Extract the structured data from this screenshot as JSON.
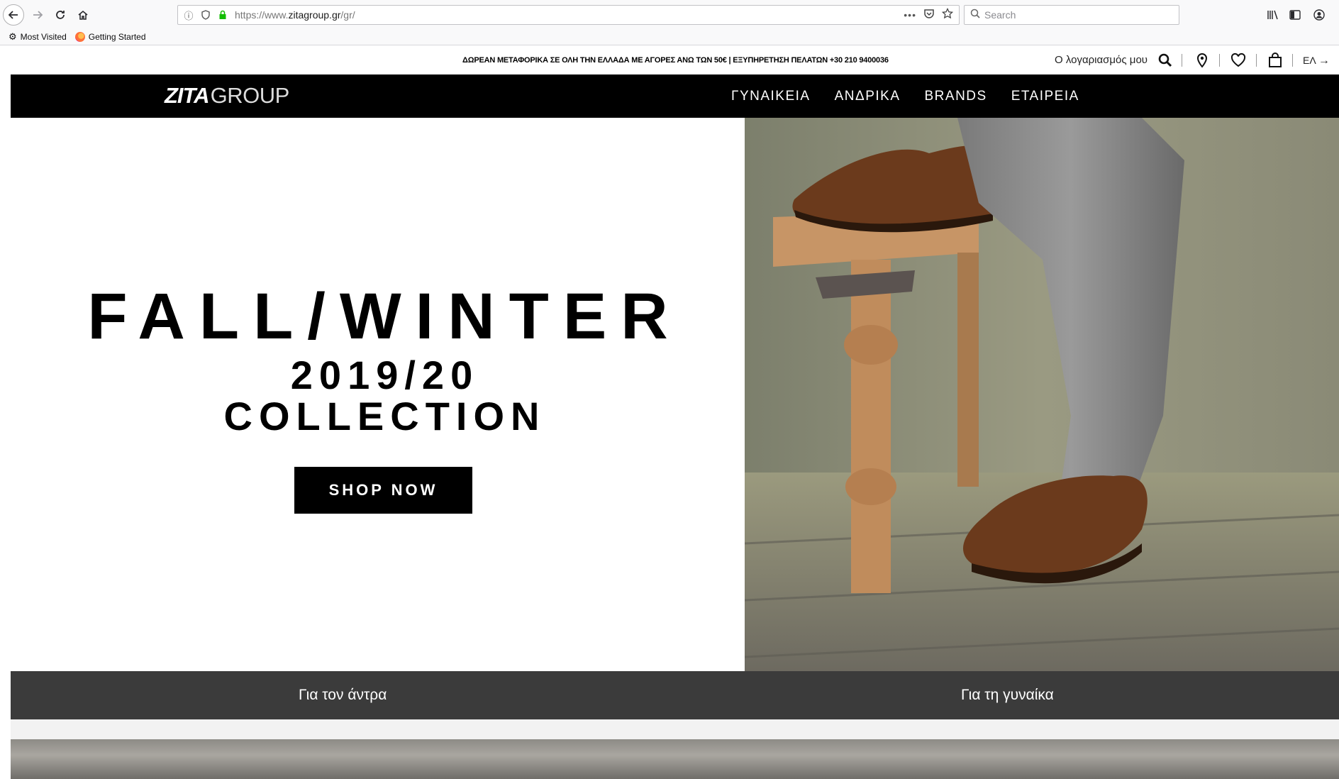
{
  "browser": {
    "url_prefix": "https://www.",
    "url_domain": "zitagroup.gr",
    "url_path": "/gr/",
    "search_placeholder": "Search",
    "bookmarks": [
      {
        "label": "Most Visited",
        "icon": "gear-icon"
      },
      {
        "label": "Getting Started",
        "icon": "firefox-icon"
      }
    ]
  },
  "topbar": {
    "promo": "ΔΩΡΕΑΝ ΜΕΤΑΦΟΡΙΚΑ ΣΕ ΟΛΗ ΤΗΝ ΕΛΛΑΔΑ ΜΕ ΑΓΟΡΕΣ ΑΝΩ ΤΩΝ 50€ | ΕΞΥΠΗΡΕΤΗΣΗ ΠΕΛΑΤΩΝ +30 210 9400036",
    "account": "Ο λογαριασμός μου",
    "lang": "ΕΛ"
  },
  "logo": {
    "bold": "ZITA",
    "light": "GROUP"
  },
  "nav": [
    "ΓΥΝΑΙΚΕΙΑ",
    "ΑΝΔΡΙΚΑ",
    "BRANDS",
    "ΕΤΑΙΡΕΙΑ"
  ],
  "hero": {
    "line1": "FALL/WINTER",
    "line2": "2019/20",
    "line3": "COLLECTION",
    "cta": "SHOP NOW"
  },
  "categories": {
    "men": "Για τον άντρα",
    "women": "Για τη γυναίκα"
  },
  "colors": {
    "nav_bg": "#000000",
    "category_bar_bg": "#3b3b3b"
  }
}
